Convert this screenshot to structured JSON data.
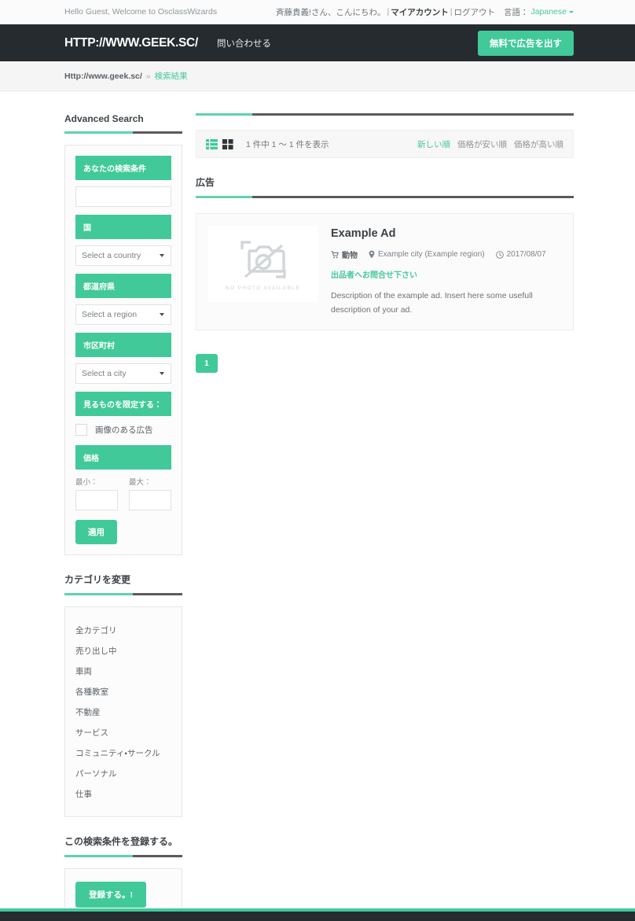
{
  "topbar": {
    "greeting": "Hello Guest, Welcome to OsclassWizards",
    "user_name": "斉藤貴義!",
    "user_suffix": " さん、こんにちわ。",
    "sep": "|",
    "my_account": "マイアカウント",
    "logout": "ログアウト",
    "language_label": "言語：",
    "language_value": "Japanese"
  },
  "navbar": {
    "brand": "HTTP://WWW.GEEK.SC/",
    "contact": "問い合わせる",
    "publish_label": "無料で広告を出す"
  },
  "breadcrumb": {
    "home": "Http://www.geek.sc/",
    "divider": "»",
    "current": "検索結果"
  },
  "sidebar": {
    "search": {
      "heading": "Advanced Search",
      "keyword_label": "あなたの検索条件",
      "keyword_value": "",
      "country_label": "国",
      "country_value": "Select a country",
      "region_label": "都道府県",
      "region_value": "Select a region",
      "city_label": "市区町村",
      "city_value": "Select a city",
      "restrict_label": "見るものを限定する：",
      "with_photo_label": "画像のある広告",
      "price_label": "価格",
      "price_min_caption": "最小：",
      "price_min_value": "",
      "price_max_caption": "最大：",
      "price_max_value": "",
      "apply_label": "適用"
    },
    "categories": {
      "heading": "カテゴリを変更",
      "items": [
        "全カテゴリ",
        "売り出し中",
        "車両",
        "各種教室",
        "不動産",
        "サービス",
        "コミュニティ・サークル",
        "パーソナル",
        "仕事"
      ]
    },
    "save_search": {
      "heading": "この検索条件を登録する。",
      "button_label": "登録する。!"
    }
  },
  "toolbar": {
    "list_view_icon": "list-view-icon",
    "grid_view_icon": "grid-view-icon",
    "result_count": "1 件中 1 〜 1 件を表示",
    "sorts": [
      {
        "label": "新しい順",
        "active": true
      },
      {
        "label": "価格が安い順",
        "active": false
      },
      {
        "label": "価格が高い順",
        "active": false
      }
    ]
  },
  "ads_section": {
    "heading": "広告",
    "items": [
      {
        "title": "Example Ad",
        "no_photo_text": "NO PHOTO AVAILABLE",
        "category": "動物",
        "location": "Example city (Example region)",
        "date": "2017/08/07",
        "contact_label": "出品者へお問合せ下さい",
        "description": "Description of the example ad. Insert here some usefull description of your ad."
      }
    ]
  },
  "pagination": {
    "pages": [
      "1"
    ]
  },
  "colors": {
    "accent": "#41c99a",
    "dark": "#252b2e",
    "rule_dark": "#5d5a5c",
    "muted": "#8e949a"
  }
}
